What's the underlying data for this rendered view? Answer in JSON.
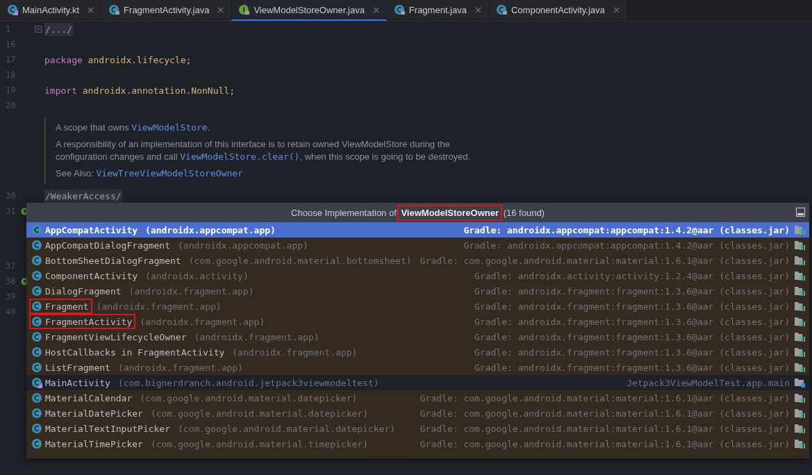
{
  "tabs": [
    {
      "label": "MainActivity.kt",
      "kind": "kotlin",
      "selected": false
    },
    {
      "label": "FragmentActivity.java",
      "kind": "class",
      "selected": false
    },
    {
      "label": "ViewModelStoreOwner.java",
      "kind": "interface",
      "selected": true
    },
    {
      "label": "Fragment.java",
      "kind": "class",
      "selected": false
    },
    {
      "label": "ComponentActivity.java",
      "kind": "class",
      "selected": false
    }
  ],
  "editor": {
    "lines": [
      {
        "kind": "code",
        "number": "1",
        "marker": false,
        "folded": true,
        "tokens": [
          {
            "text": "/.../",
            "kind": "fold"
          }
        ]
      },
      {
        "kind": "code",
        "number": "16",
        "marker": false,
        "folded": false
      },
      {
        "kind": "code",
        "number": "17",
        "marker": false,
        "folded": false,
        "tokens": [
          {
            "text": "package",
            "kind": "keyword"
          },
          {
            "text": " androidx.lifecycle",
            "kind": "ident"
          },
          {
            "text": ";",
            "kind": "plain"
          }
        ]
      },
      {
        "kind": "code",
        "number": "18",
        "marker": false,
        "folded": false
      },
      {
        "kind": "code",
        "number": "19",
        "marker": false,
        "folded": false,
        "tokens": [
          {
            "text": "import",
            "kind": "keyword"
          },
          {
            "text": " androidx.annotation.NonNull",
            "kind": "ident"
          },
          {
            "text": ";",
            "kind": "plain"
          }
        ]
      },
      {
        "kind": "code",
        "number": "20",
        "marker": false,
        "folded": false
      },
      {
        "kind": "doc",
        "paragraphs": [
          [
            {
              "text": "A scope that owns ",
              "kind": "text"
            },
            {
              "text": "ViewModelStore",
              "kind": "link"
            },
            {
              "text": ".",
              "kind": "text"
            }
          ],
          [
            {
              "text": "A responsibility of an implementation of this interface is to retain owned ViewModelStore during the configuration changes and call ",
              "kind": "text"
            },
            {
              "text": "ViewModelStore.clear()",
              "kind": "link"
            },
            {
              "text": ", when this scope is going to be destroyed.",
              "kind": "text"
            }
          ],
          [
            {
              "text": "See Also: ",
              "kind": "text"
            },
            {
              "text": "ViewTreeViewModelStoreOwner",
              "kind": "link"
            }
          ]
        ]
      },
      {
        "kind": "code",
        "number": "30",
        "marker": false,
        "folded": false,
        "tokens": [
          {
            "text": "/WeakerAccess/",
            "kind": "fold"
          }
        ]
      },
      {
        "kind": "code",
        "number": "31",
        "marker": true,
        "folded": false
      }
    ],
    "lines_under_popup": [
      {
        "number": "37",
        "marker": false
      },
      {
        "number": "38",
        "marker": true
      },
      {
        "number": "39",
        "marker": false
      },
      {
        "number": "40",
        "marker": false
      }
    ]
  },
  "popup": {
    "header": "Choose Implementation of **ViewModelStoreOwner** (16 found)",
    "header_boxed": true,
    "rows": [
      {
        "kind": "library",
        "name": "AppCompatActivity",
        "package": "(androidx.appcompat.app)",
        "location": "Gradle: androidx.appcompat:appcompat:1.4.2@aar (classes.jar)",
        "selected": true,
        "boxed": false
      },
      {
        "kind": "library",
        "name": "AppCompatDialogFragment",
        "package": "(androidx.appcompat.app)",
        "location": "Gradle: androidx.appcompat:appcompat:1.4.2@aar (classes.jar)",
        "selected": false,
        "boxed": false
      },
      {
        "kind": "library",
        "name": "BottomSheetDialogFragment",
        "package": "(com.google.android.material.bottomsheet)",
        "location": "Gradle: com.google.android.material:material:1.6.1@aar (classes.jar)",
        "selected": false,
        "boxed": false
      },
      {
        "kind": "library",
        "name": "ComponentActivity",
        "package": "(androidx.activity)",
        "location": "Gradle: androidx.activity:activity:1.2.4@aar (classes.jar)",
        "selected": false,
        "boxed": false
      },
      {
        "kind": "library",
        "name": "DialogFragment",
        "package": "(androidx.fragment.app)",
        "location": "Gradle: androidx.fragment:fragment:1.3.6@aar (classes.jar)",
        "selected": false,
        "boxed": false
      },
      {
        "kind": "library",
        "name": "Fragment",
        "package": "(androidx.fragment.app)",
        "location": "Gradle: androidx.fragment:fragment:1.3.6@aar (classes.jar)",
        "selected": false,
        "boxed": true
      },
      {
        "kind": "library",
        "name": "FragmentActivity",
        "package": "(androidx.fragment.app)",
        "location": "Gradle: androidx.fragment:fragment:1.3.6@aar (classes.jar)",
        "selected": false,
        "boxed": true
      },
      {
        "kind": "library",
        "name": "FragmentViewLifecycleOwner",
        "package": "(androidx.fragment.app)",
        "location": "Gradle: androidx.fragment:fragment:1.3.6@aar (classes.jar)",
        "selected": false,
        "boxed": false
      },
      {
        "kind": "library",
        "name": "HostCallbacks in FragmentActivity",
        "package": "(androidx.fragment.app)",
        "location": "Gradle: androidx.fragment:fragment:1.3.6@aar (classes.jar)",
        "selected": false,
        "boxed": false
      },
      {
        "kind": "library",
        "name": "ListFragment",
        "package": "(androidx.fragment.app)",
        "location": "Gradle: androidx.fragment:fragment:1.3.6@aar (classes.jar)",
        "selected": false,
        "boxed": false
      },
      {
        "kind": "project",
        "name": "MainActivity",
        "package": "(com.bignerdranch.android.jetpack3viewmodeltest)",
        "location": "Jetpack3ViewModelTest.app.main",
        "selected": false,
        "boxed": false
      },
      {
        "kind": "library",
        "name": "MaterialCalendar",
        "package": "(com.google.android.material.datepicker)",
        "location": "Gradle: com.google.android.material:material:1.6.1@aar (classes.jar)",
        "selected": false,
        "boxed": false
      },
      {
        "kind": "library",
        "name": "MaterialDatePicker",
        "package": "(com.google.android.material.datepicker)",
        "location": "Gradle: com.google.android.material:material:1.6.1@aar (classes.jar)",
        "selected": false,
        "boxed": false
      },
      {
        "kind": "library",
        "name": "MaterialTextInputPicker",
        "package": "(com.google.android.material.datepicker)",
        "location": "Gradle: com.google.android.material:material:1.6.1@aar (classes.jar)",
        "selected": false,
        "boxed": false
      },
      {
        "kind": "library",
        "name": "MaterialTimePicker",
        "package": "(com.google.android.material.timepicker)",
        "location": "Gradle: com.google.android.material:material:1.6.1@aar (classes.jar)",
        "selected": false,
        "boxed": false
      }
    ]
  }
}
